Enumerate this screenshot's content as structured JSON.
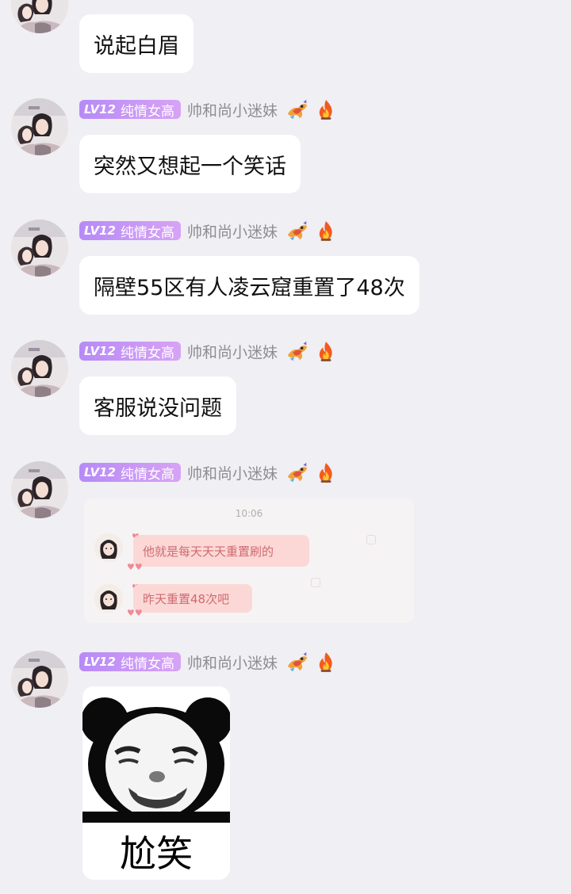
{
  "sender": {
    "level_badge": "LV12",
    "title": "纯情女高",
    "nickname": "帅和尚小迷妹",
    "decoration_icons": [
      "dragon-icon",
      "fire-icon"
    ]
  },
  "messages": [
    {
      "type": "text",
      "text": "说起白眉"
    },
    {
      "type": "text",
      "text": "突然又想起一个笑话"
    },
    {
      "type": "text",
      "text": "隔壁55区有人凌云窟重置了48次"
    },
    {
      "type": "text",
      "text": "客服说没问题"
    },
    {
      "type": "image_screenshot",
      "time": "10:06",
      "lines": [
        "他就是每天天天重置刷的",
        "昨天重置48次吧"
      ]
    },
    {
      "type": "sticker",
      "icon": "panda-face-icon",
      "caption": "尬笑"
    }
  ],
  "colors": {
    "background": "#efeff4",
    "badge_start": "#b78af7",
    "badge_end": "#d7a3f5",
    "nickname": "#8d8d93",
    "screenshot_bubble": "#fbd8d6",
    "screenshot_text": "#d06a71"
  }
}
